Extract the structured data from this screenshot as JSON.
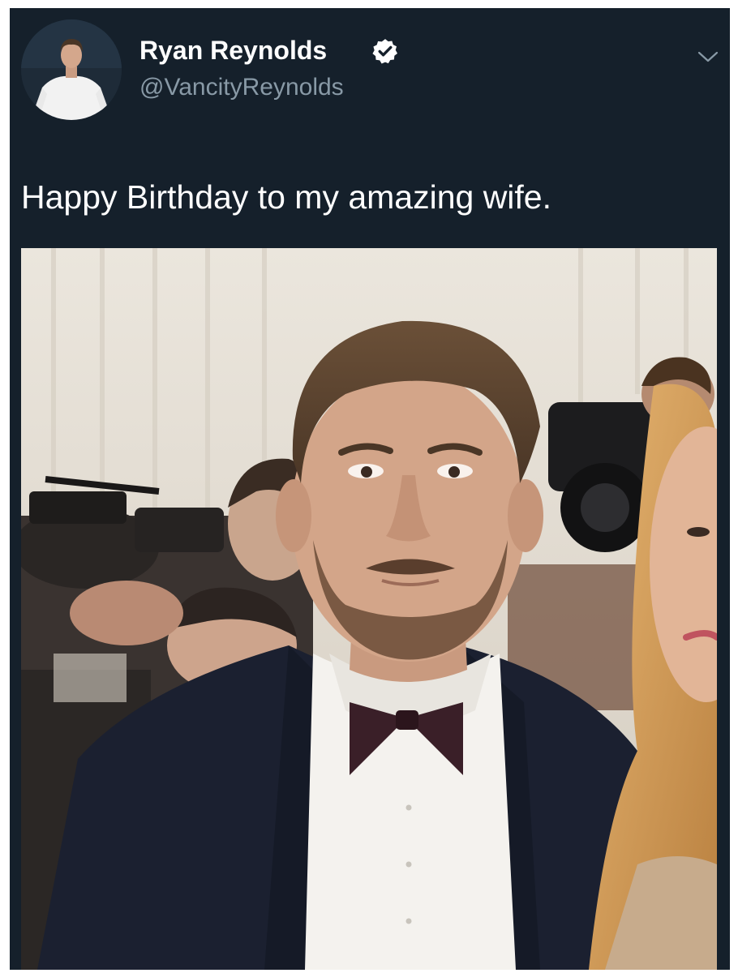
{
  "tweet": {
    "author": {
      "display_name": "Ryan Reynolds",
      "handle": "@VancityReynolds",
      "verified": true,
      "verified_icon": "verified-badge-icon",
      "avatar_alt": "profile picture"
    },
    "menu_icon": "chevron-down-icon",
    "text": "Happy Birthday to my amazing wife.",
    "media": {
      "type": "photo",
      "alt": "man in tuxedo with bow tie at event"
    }
  },
  "colors": {
    "background": "#15202b",
    "name": "#ffffff",
    "handle": "#8899a6",
    "text": "#ffffff",
    "verified": "#ffffff"
  }
}
